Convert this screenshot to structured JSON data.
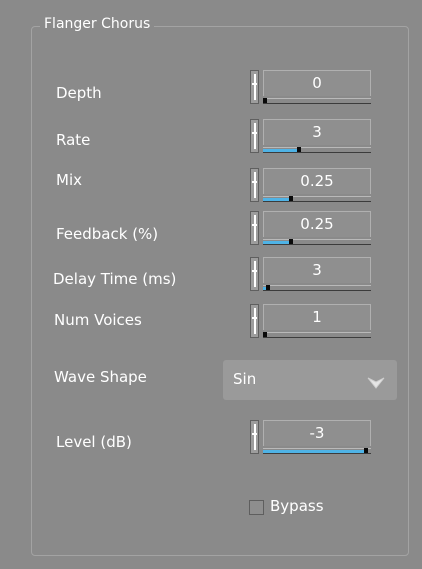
{
  "group": {
    "title": "Flanger Chorus"
  },
  "params": [
    {
      "id": "depth",
      "label": "Depth",
      "value": "0",
      "level": 0.0
    },
    {
      "id": "rate",
      "label": "Rate",
      "value": "3",
      "level": 0.33
    },
    {
      "id": "mix",
      "label": "Mix",
      "value": "0.25",
      "level": 0.25
    },
    {
      "id": "feedback",
      "label": "Feedback (%)",
      "value": "0.25",
      "level": 0.25
    },
    {
      "id": "delay",
      "label": "Delay Time (ms)",
      "value": "3",
      "level": 0.03
    },
    {
      "id": "voices",
      "label": "Num Voices",
      "value": "1",
      "level": 0.0
    },
    {
      "id": "level",
      "label": "Level (dB)",
      "value": "-3",
      "level": 0.97
    }
  ],
  "wave_shape": {
    "label": "Wave Shape",
    "selected": "Sin"
  },
  "bypass": {
    "label": "Bypass",
    "checked": false
  },
  "colors": {
    "accent": "#4fb3e6",
    "background": "#8a8a8a"
  }
}
